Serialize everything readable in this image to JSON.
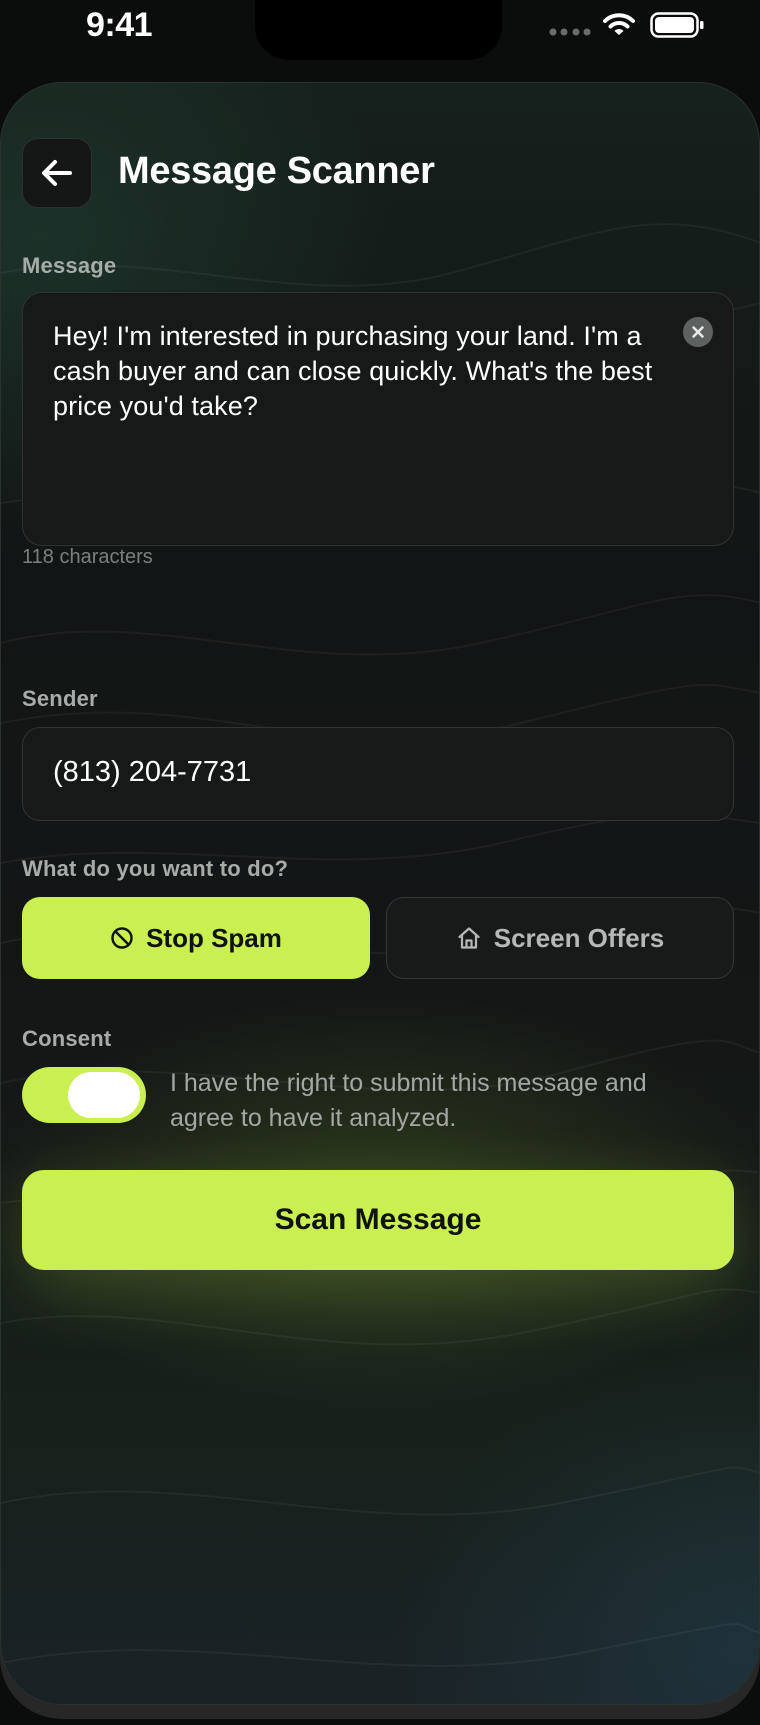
{
  "status_bar": {
    "time": "9:41"
  },
  "header": {
    "title": "Message Scanner"
  },
  "message": {
    "label": "Message",
    "text": "Hey! I'm interested in purchasing your land. I'm a cash buyer and can close quickly. What's the best price you'd take?",
    "char_count": "118 characters"
  },
  "sender": {
    "label": "Sender",
    "value": "(813) 204-7731"
  },
  "intent": {
    "label": "What do you want to do?",
    "options": [
      {
        "label": "Stop Spam",
        "icon": "ban-icon",
        "selected": true
      },
      {
        "label": "Screen Offers",
        "icon": "home-icon",
        "selected": false
      }
    ]
  },
  "consent": {
    "label": "Consent",
    "text": "I have the right to submit this message and agree to have it analyzed.",
    "enabled": true
  },
  "actions": {
    "scan_label": "Scan Message"
  },
  "colors": {
    "accent": "#c9f050",
    "background": "#0b0c0c",
    "surface": "#161918"
  }
}
